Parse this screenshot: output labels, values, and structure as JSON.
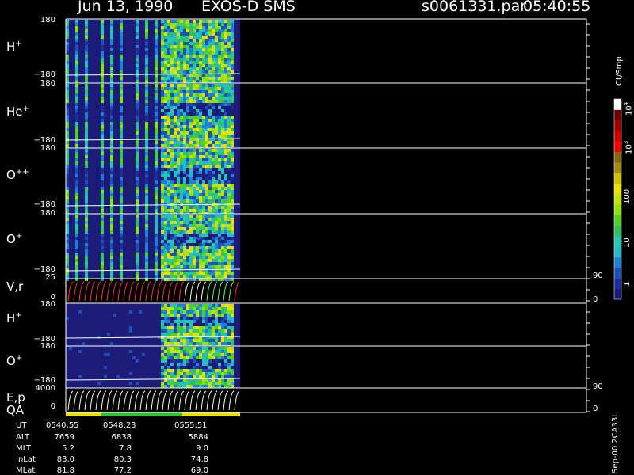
{
  "header": {
    "date": "Jun 13, 1990",
    "mission": "EXOS-D SMS",
    "file": "s0061331.par",
    "time": "05:40:55"
  },
  "colorbar": {
    "label": "Ct/Smp",
    "ticks": [
      "1",
      "10",
      "100",
      "10",
      "10"
    ],
    "tick_exps": [
      "",
      "",
      "",
      "3",
      "4"
    ],
    "colors": [
      "#1c1c78",
      "#1f2d9a",
      "#1f4fb8",
      "#1f7fd4",
      "#25b8c8",
      "#1fc8b0",
      "#30c060",
      "#50d020",
      "#90e010",
      "#c0e010",
      "#e8e000",
      "#d0c000",
      "#a08a10",
      "#806a10",
      "#ff0000",
      "#d00000",
      "#a00000",
      "#700000",
      "#ffffff"
    ]
  },
  "panels": [
    {
      "id": "h-plus",
      "label": "H",
      "sup": "+",
      "top_tick": "180",
      "bottom_tick": "−180"
    },
    {
      "id": "he-plus",
      "label": "He",
      "sup": "+",
      "top_tick": "180",
      "bottom_tick": "−180"
    },
    {
      "id": "o-plusplus",
      "label": "O",
      "sup": "++",
      "top_tick": "180",
      "bottom_tick": "−180"
    },
    {
      "id": "o-plus",
      "label": "O",
      "sup": "+",
      "top_tick": "180",
      "bottom_tick": "−180"
    },
    {
      "id": "vr",
      "label": "V,r",
      "sup": "",
      "top_tick": "25",
      "bottom_tick": "0",
      "right_top": "90",
      "right_bottom": "0"
    },
    {
      "id": "h-plus-2",
      "label": "H",
      "sup": "+",
      "top_tick": "180",
      "bottom_tick": "−180"
    },
    {
      "id": "o-plus-2",
      "label": "O",
      "sup": "+",
      "top_tick": "180",
      "bottom_tick": "−180"
    },
    {
      "id": "ep",
      "label": "E,p",
      "sup": "",
      "top_tick": "4000",
      "bottom_tick": "0",
      "right_top": "90",
      "right_bottom": "0"
    }
  ],
  "qa_label": "QA",
  "footer": {
    "row_labels": [
      "UT",
      "ALT",
      "MLT",
      "InLat",
      "MLat"
    ],
    "columns": [
      [
        "0540:55",
        "7659",
        "5.2",
        "83.0",
        "81.8"
      ],
      [
        "0548:23",
        "6838",
        "7.8",
        "80.3",
        "77.2"
      ],
      [
        "0555:51",
        "5884",
        "9.0",
        "74.8",
        "69.0"
      ]
    ]
  },
  "side_text": "Sep-00 2CA33L",
  "chart_data": {
    "type": "heatmap",
    "note_panels": [
      "H+",
      "He+",
      "O++",
      "O+",
      "V,r",
      "H+",
      "O+",
      "E,p"
    ],
    "y_ranges": {
      "pitch_panels": [
        -180,
        180
      ],
      "vr": [
        0,
        25
      ],
      "ep": [
        0,
        4000
      ]
    },
    "x_ticks": [
      "0540:55",
      "0548:23",
      "0555:51"
    ]
  }
}
